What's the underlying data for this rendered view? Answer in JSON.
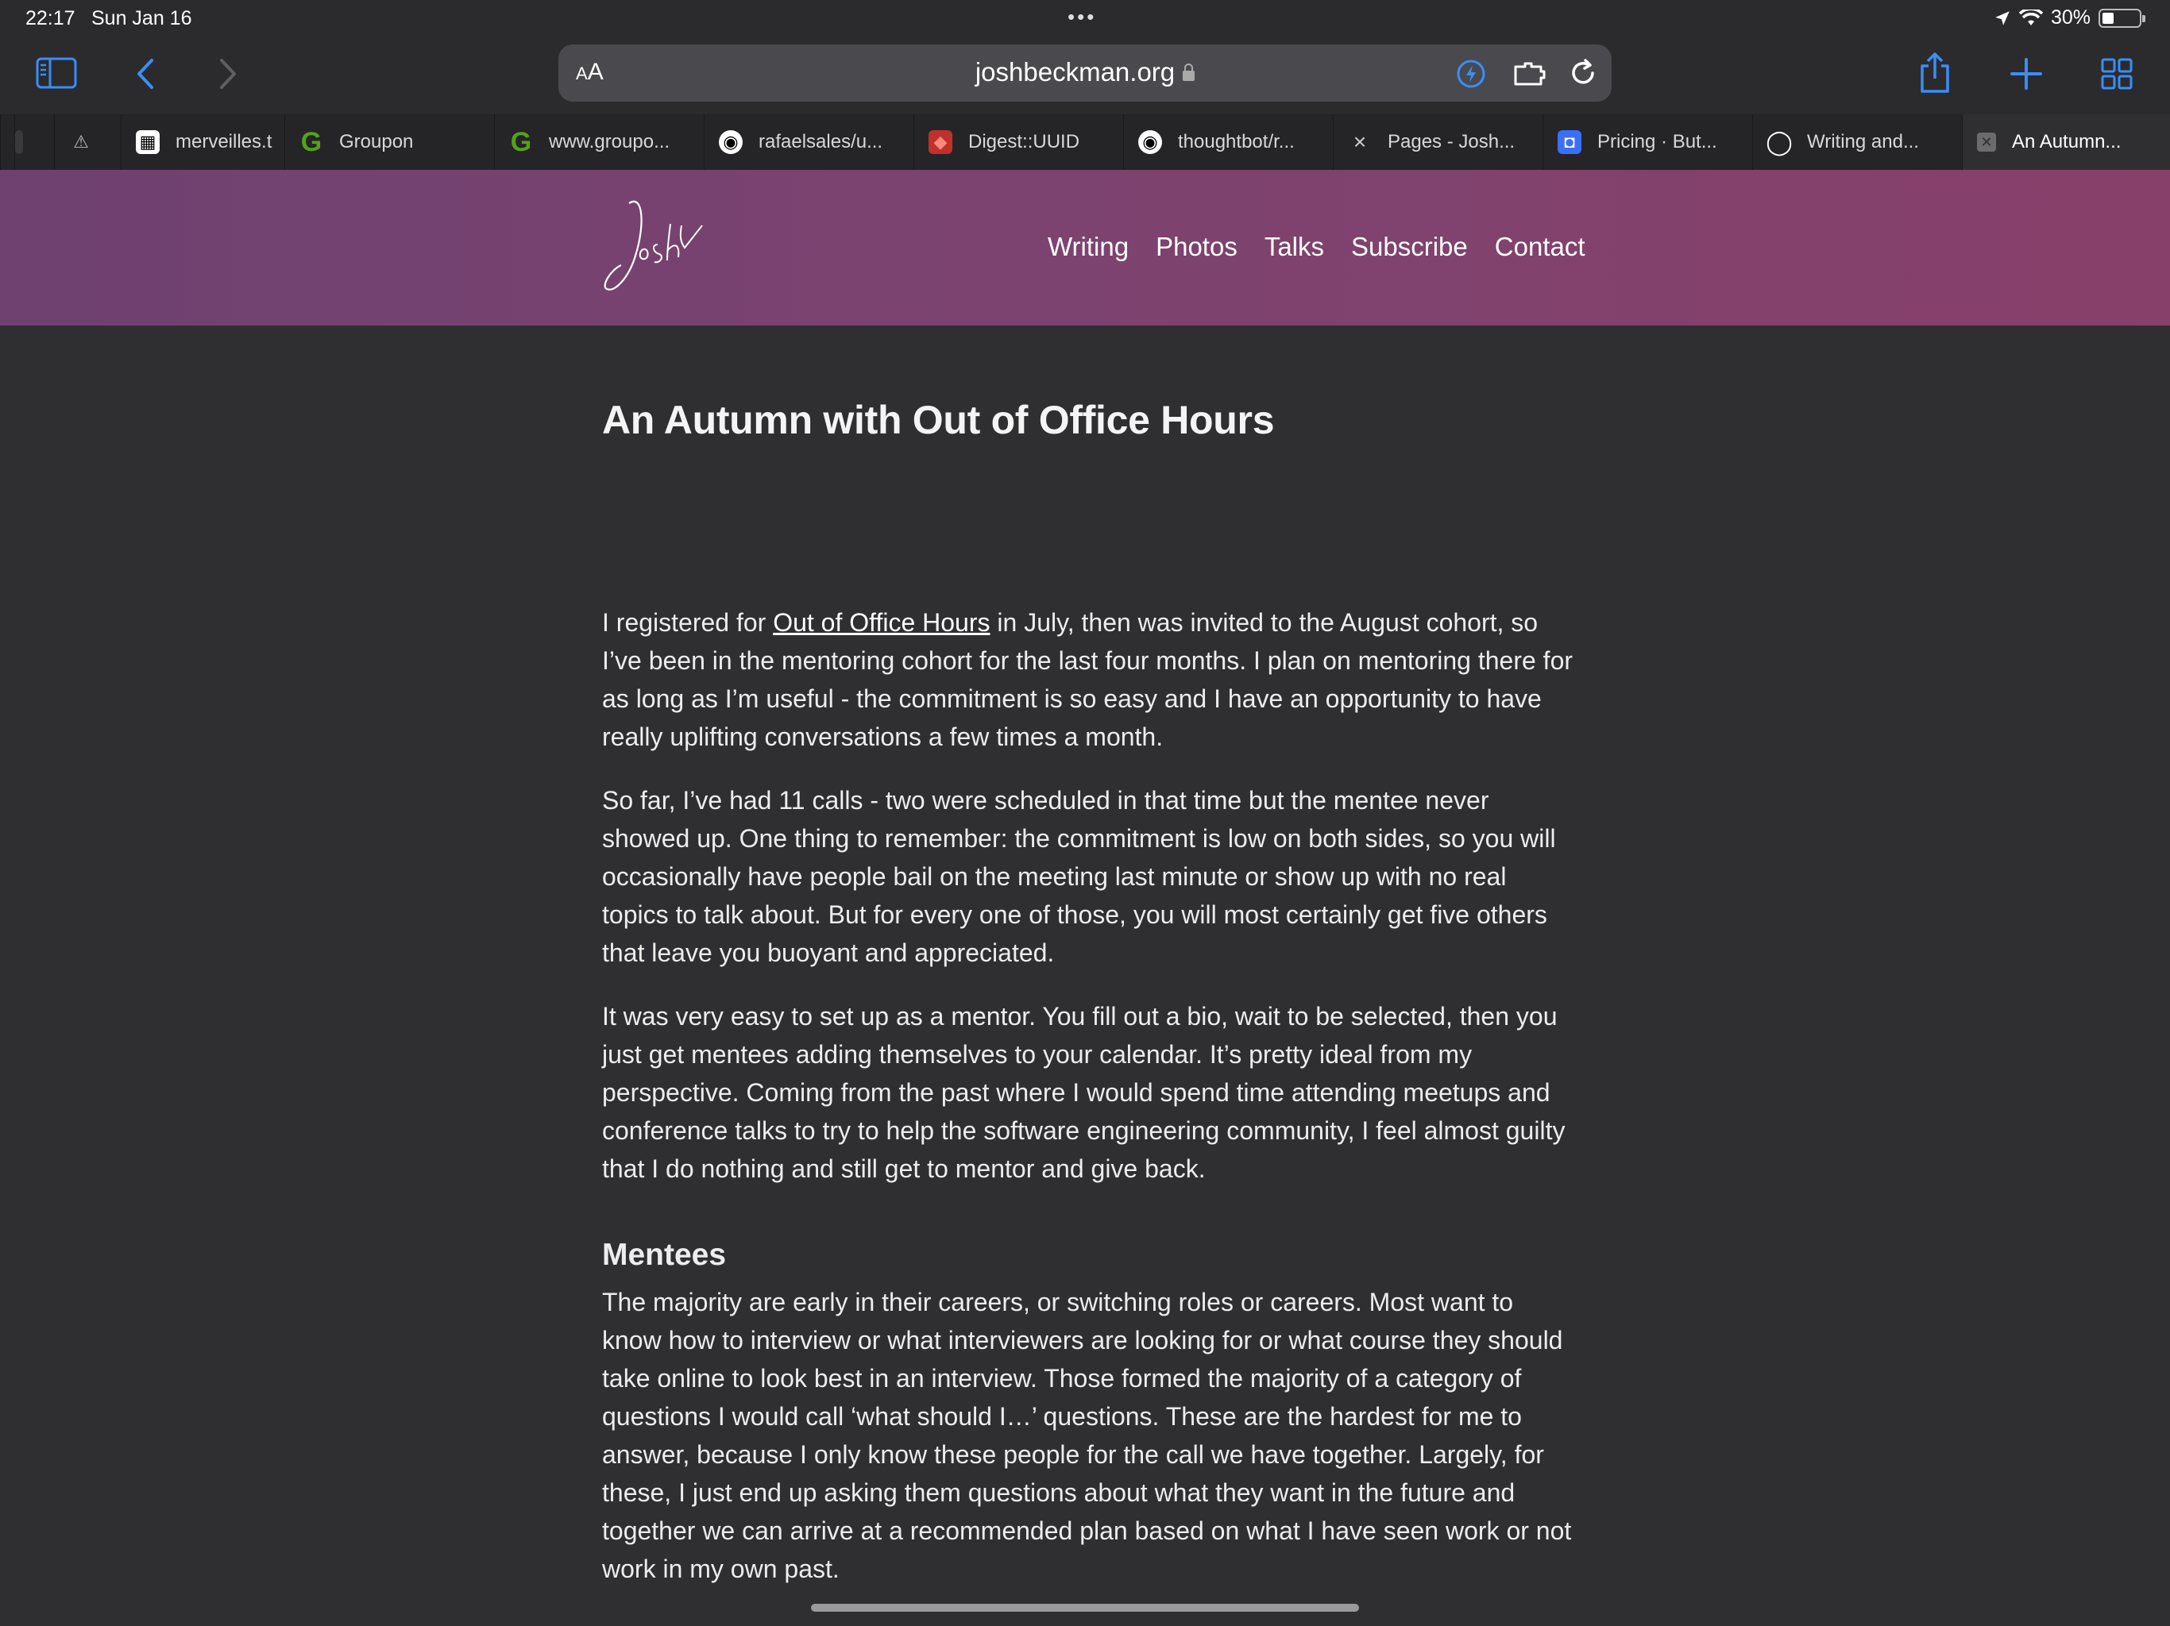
{
  "status": {
    "time": "22:17",
    "date": "Sun Jan 16",
    "battery": "30%"
  },
  "toolbar": {
    "aa": "A",
    "aa_big": "A",
    "url": "joshbeckman.org"
  },
  "tabs": [
    {
      "label": "",
      "fav": "",
      "color": "#3a3a3c"
    },
    {
      "label": "",
      "fav": "⚠",
      "color": "#3a3a3c"
    },
    {
      "label": "merveilles.t",
      "fav": "▦",
      "color": "#ffffff"
    },
    {
      "label": "Groupon",
      "fav": "G",
      "color": "#53a318"
    },
    {
      "label": "www.groupo...",
      "fav": "G",
      "color": "#53a318"
    },
    {
      "label": "rafaelsales/u...",
      "fav": "◉",
      "color": "#ffffff"
    },
    {
      "label": "Digest::UUID",
      "fav": "◆",
      "color": "#c0312b"
    },
    {
      "label": "thoughtbot/r...",
      "fav": "◉",
      "color": "#ffffff"
    },
    {
      "label": "Pages - Josh...",
      "fav": "×",
      "color": "#252527"
    },
    {
      "label": "Pricing · But...",
      "fav": "◘",
      "color": "#3a6ff7"
    },
    {
      "label": "Writing and...",
      "fav": "◯",
      "color": "#252527"
    },
    {
      "label": "An Autumn...",
      "fav": "✕",
      "color": "#6b6b6d"
    }
  ],
  "site": {
    "logo": "Josh",
    "nav": [
      "Writing",
      "Photos",
      "Talks",
      "Subscribe",
      "Contact"
    ]
  },
  "article": {
    "title": "An Autumn with Out of Office Hours",
    "p1_before": "I registered for ",
    "p1_link": "Out of Office Hours",
    "p1_after": " in July, then was invited to the August cohort, so I’ve been in the mentoring cohort for the last four months. I plan on mentoring there for as long as I’m useful - the commitment is so easy and I have an opportunity to have really uplifting conversations a few times a month.",
    "p2": "So far, I’ve had 11 calls - two were scheduled in that time but the mentee never showed up. One thing to remember: the commitment is low on both sides, so you will occasionally have people bail on the meeting last minute or show up with no real topics to talk about. But for every one of those, you will most certainly get five others that leave you buoyant and appreciated.",
    "p3": "It was very easy to set up as a mentor. You fill out a bio, wait to be selected, then you just get mentees adding themselves to your calendar. It’s pretty ideal from my perspective. Coming from the past where I would spend time attending meetups and conference talks to try to help the software engineering community, I feel almost guilty that I do nothing and still get to mentor and give back.",
    "h2": "Mentees",
    "p4": "The majority are early in their careers, or switching roles or careers. Most want to know how to interview or what interviewers are looking for or what course they should take online to look best in an interview. Those formed the majority of a category of questions I would call ‘what should I…’ questions. These are the hardest for me to answer, because I only know these people for the call we have together. Largely, for these, I just end up asking them questions about what they want in the future and together we can arrive at a recommended plan based on what I have seen work or not work in my own past."
  }
}
